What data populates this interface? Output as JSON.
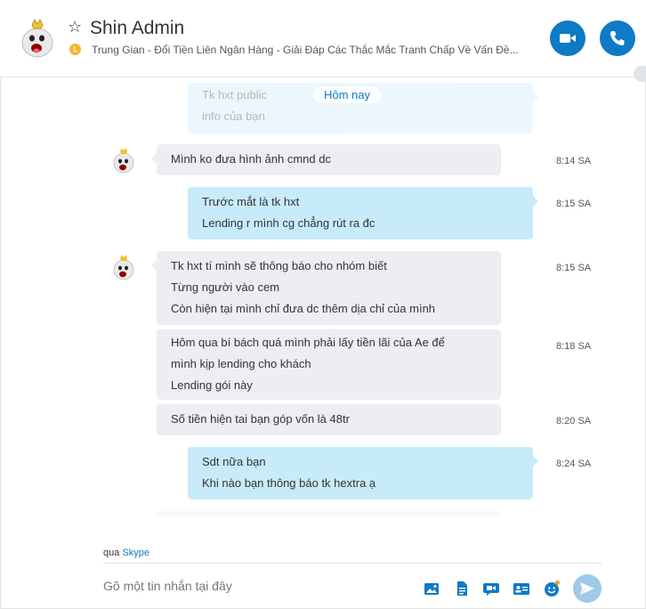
{
  "header": {
    "title": "Shin Admin",
    "mood": "Trung Gian - Đổi Tiền Liên Ngân Hàng - Giải Đáp Các Thắc Mắc Tranh Chấp Về Vấn Đề...",
    "video_icon": "video-camera-icon",
    "call_icon": "phone-icon"
  },
  "date_label": "Hôm nay",
  "faded_top": {
    "line1": "Tk hxt public",
    "line2": "info của bạn"
  },
  "messages": [
    {
      "dir": "in",
      "lines": [
        "Mình ko đưa hình ảnh cmnd dc"
      ],
      "time": "8:14 SA"
    },
    {
      "dir": "out",
      "lines": [
        "Trước mắt là tk hxt",
        "Lending r mình cg chẳng rút ra đc"
      ],
      "time": "8:15 SA"
    },
    {
      "dir": "in",
      "lines": [
        "Tk hxt tí mình sẽ thông báo cho nhóm biết",
        "Từng người vào cem",
        "Còn hiện tại mình chỉ đưa dc thêm dịa chỉ của mình"
      ],
      "time": "8:15 SA"
    },
    {
      "dir": "in",
      "lines": [
        "Hôm qua bí bách quá mình phải lấy tiền lãi của Ae để",
        "mình kịp lending cho khách",
        "Lending gói này"
      ],
      "time": "8:18 SA"
    },
    {
      "dir": "in",
      "lines": [
        "Số tiền hiện tai bạn góp vốn là 48tr"
      ],
      "time": "8:20 SA"
    },
    {
      "dir": "out",
      "lines": [
        "Sdt nữa bạn",
        "Khi nào bạn thông báo tk hextra ạ"
      ],
      "time": "8:24 SA"
    }
  ],
  "footer": {
    "via_prefix": "qua",
    "via_link": "Skype",
    "composer_placeholder": "Gõ một tin nhắn tại đây",
    "tools": [
      "media-gallery-icon",
      "file-icon",
      "video-message-icon",
      "contact-card-icon",
      "emoticon-icon",
      "send-icon"
    ]
  },
  "colors": {
    "accent": "#0f7ac6",
    "incoming_bubble": "#eceef1",
    "outgoing_bubble": "#c8ebfa",
    "mood_icon": "#f5b731",
    "send_disabled": "#9fc9e8"
  }
}
